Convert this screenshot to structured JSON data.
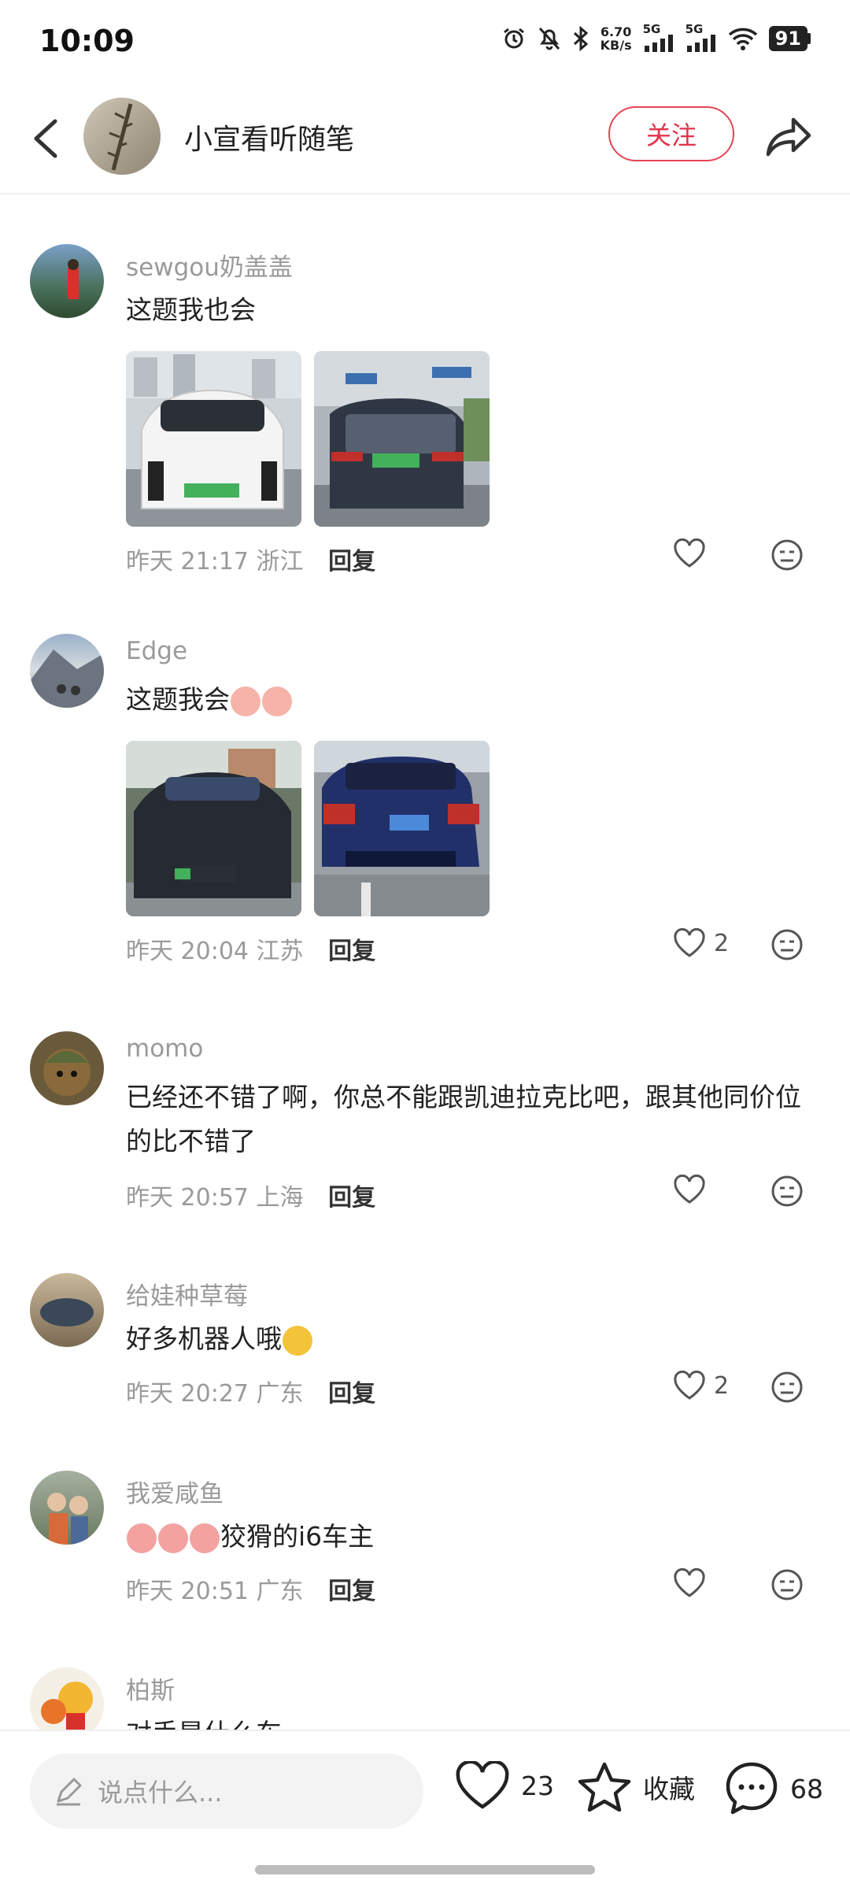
{
  "status_bar": {
    "time": "10:09",
    "net_speed_value": "6.70",
    "net_speed_unit": "KB/s",
    "sim1": "5G",
    "sim2": "5G",
    "battery": "91"
  },
  "header": {
    "title": "小宣看听随笔",
    "follow_label": "关注"
  },
  "comments": [
    {
      "user": "sewgou奶盖盖",
      "text": "这题我也会",
      "time": "昨天 21:17",
      "location": "浙江",
      "reply": "回复",
      "likes": ""
    },
    {
      "user": "Edge",
      "text": "这题我会",
      "time": "昨天 20:04",
      "location": "江苏",
      "reply": "回复",
      "likes": "2"
    },
    {
      "user": "momo",
      "text": "已经还不错了啊，你总不能跟凯迪拉克比吧，跟其他同价位的比不错了",
      "time": "昨天 20:57",
      "location": "上海",
      "reply": "回复",
      "likes": ""
    },
    {
      "user": "给娃种草莓",
      "text": "好多机器人哦",
      "time": "昨天 20:27",
      "location": "广东",
      "reply": "回复",
      "likes": "2"
    },
    {
      "user": "我爱咸鱼",
      "text": "狡猾的i6车主",
      "time": "昨天 20:51",
      "location": "广东",
      "reply": "回复",
      "likes": ""
    },
    {
      "user": "柏斯",
      "text": "对手是什么车"
    }
  ],
  "bottom_bar": {
    "input_placeholder": "说点什么...",
    "likes": "23",
    "favorite_label": "收藏",
    "comments": "68"
  }
}
